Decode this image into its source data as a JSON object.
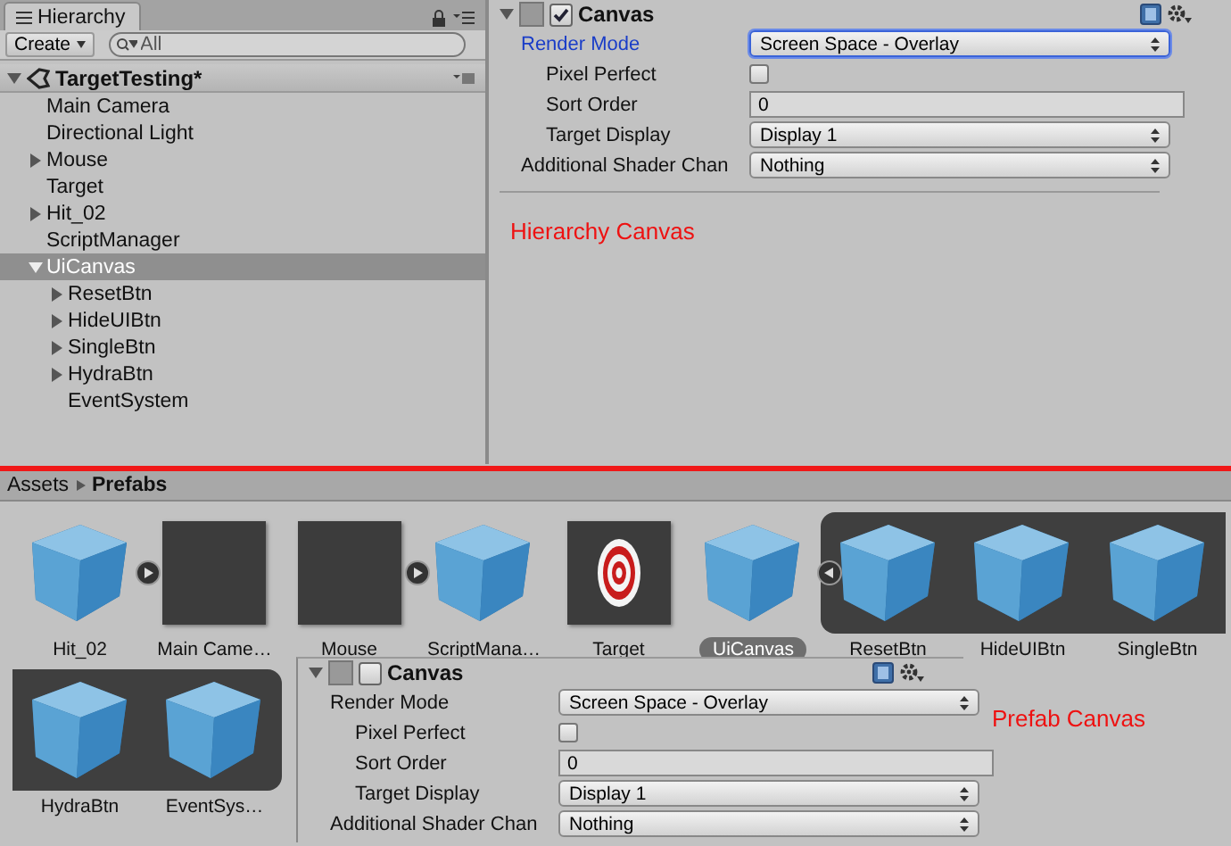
{
  "hierarchy": {
    "tab": "Hierarchy",
    "create_button": "Create",
    "search": {
      "placeholder": "All"
    },
    "scene": "TargetTesting*",
    "items": [
      {
        "name": "Main Camera",
        "selected": false
      },
      {
        "name": "Directional Light",
        "selected": false
      },
      {
        "name": "Mouse",
        "selected": false,
        "expanded": false
      },
      {
        "name": "Target",
        "selected": false
      },
      {
        "name": "Hit_02",
        "selected": false,
        "expanded": false
      },
      {
        "name": "ScriptManager",
        "selected": false
      },
      {
        "name": "UiCanvas",
        "selected": true,
        "expanded": true,
        "children": [
          {
            "name": "ResetBtn",
            "selected": false,
            "expanded": false
          },
          {
            "name": "HideUIBtn",
            "selected": false,
            "expanded": false
          },
          {
            "name": "SingleBtn",
            "selected": false,
            "expanded": false
          },
          {
            "name": "HydraBtn",
            "selected": false,
            "expanded": false
          },
          {
            "name": "EventSystem",
            "selected": false
          }
        ]
      }
    ]
  },
  "inspector": {
    "component": {
      "title": "Canvas",
      "enabled": true,
      "fields": [
        {
          "label": "Render Mode",
          "kind": "dropdown",
          "value": "Screen Space - Overlay",
          "indented": false,
          "focused": true
        },
        {
          "label": "Pixel Perfect",
          "kind": "checkbox",
          "checked": false,
          "indented": true,
          "focused": false
        },
        {
          "label": "Sort Order",
          "kind": "text",
          "value": "0",
          "indented": true,
          "focused": false
        },
        {
          "label": "Target Display",
          "kind": "dropdown",
          "value": "Display 1",
          "indented": true,
          "focused": false
        },
        {
          "label": "Additional Shader Chan",
          "kind": "dropdown",
          "value": "Nothing",
          "indented": false,
          "focused": false
        }
      ]
    },
    "annotation": "Hierarchy Canvas"
  },
  "project": {
    "breadcrumb": [
      "Assets",
      "Prefabs"
    ],
    "assets": [
      {
        "name": "Hit_02",
        "kind": "cube",
        "expanded": false,
        "selected": false,
        "in_group": false
      },
      {
        "name": "Main Came…",
        "kind": "empty",
        "selected": false,
        "in_group": false
      },
      {
        "name": "Mouse",
        "kind": "empty",
        "expanded": false,
        "selected": false,
        "in_group": false
      },
      {
        "name": "ScriptMana…",
        "kind": "cube",
        "selected": false,
        "in_group": false
      },
      {
        "name": "Target",
        "kind": "target",
        "selected": false,
        "in_group": false
      },
      {
        "name": "UiCanvas",
        "kind": "cube",
        "expanded": true,
        "selected": true,
        "in_group": false
      },
      {
        "name": "ResetBtn",
        "kind": "cube",
        "selected": false,
        "in_group": true
      },
      {
        "name": "HideUIBtn",
        "kind": "cube",
        "selected": false,
        "in_group": true
      },
      {
        "name": "SingleBtn",
        "kind": "cube",
        "selected": false,
        "in_group": true
      },
      {
        "name": "HydraBtn",
        "kind": "cube",
        "selected": false,
        "in_group": true
      },
      {
        "name": "EventSys…",
        "kind": "cube",
        "selected": false,
        "in_group": true
      }
    ],
    "inspector": {
      "component": {
        "title": "Canvas",
        "enabled": false,
        "fields": [
          {
            "label": "Render Mode",
            "kind": "dropdown",
            "value": "Screen Space - Overlay",
            "indented": false,
            "focused": false
          },
          {
            "label": "Pixel Perfect",
            "kind": "checkbox",
            "checked": false,
            "indented": true,
            "focused": false
          },
          {
            "label": "Sort Order",
            "kind": "text",
            "value": "0",
            "indented": true,
            "focused": false
          },
          {
            "label": "Target Display",
            "kind": "dropdown",
            "value": "Display 1",
            "indented": true,
            "focused": false
          },
          {
            "label": "Additional Shader Chan",
            "kind": "dropdown",
            "value": "Nothing",
            "indented": false,
            "focused": false
          }
        ]
      },
      "annotation": "Prefab Canvas"
    }
  }
}
